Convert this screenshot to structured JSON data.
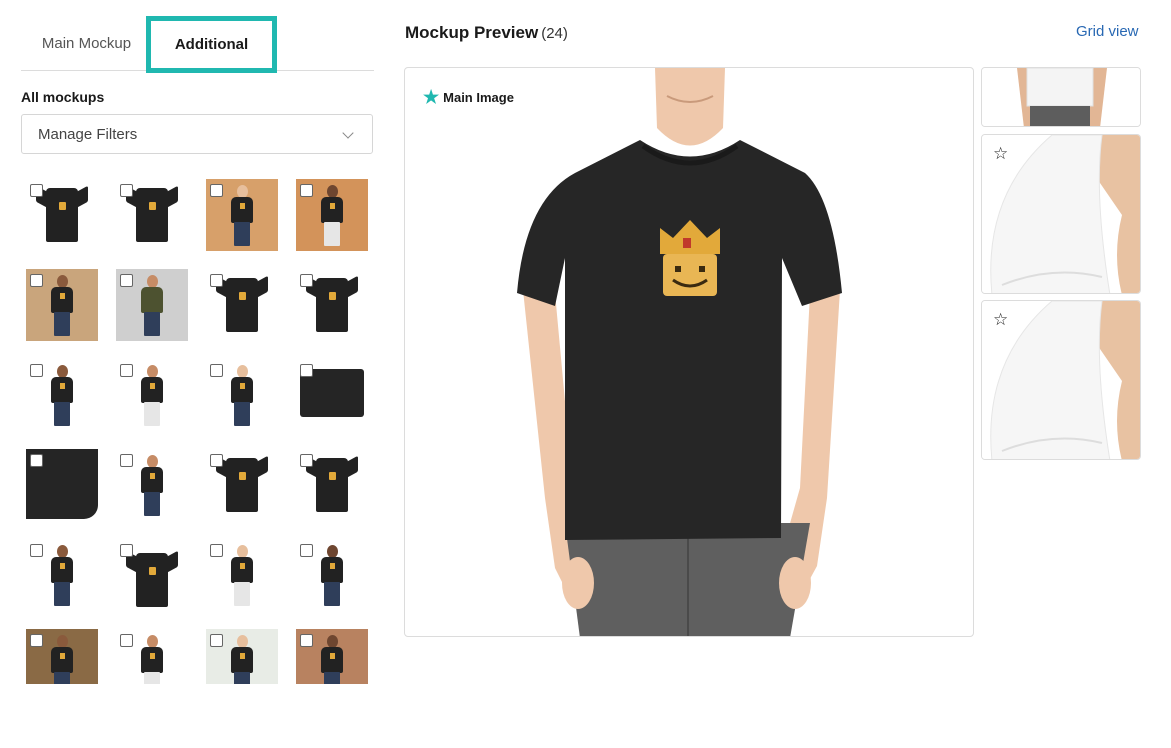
{
  "tabs": {
    "main_label": "Main Mockup",
    "additional_label": "Additional",
    "active": "Additional"
  },
  "filters": {
    "section_title": "All mockups",
    "select_label": "Manage Filters"
  },
  "preview": {
    "title": "Mockup Preview",
    "count": "(24)",
    "grid_view_label": "Grid view",
    "main_image_label": "Main Image"
  },
  "thumbnails": [
    {
      "kind": "flat-shirt",
      "bg": "#ffffff",
      "checked": false
    },
    {
      "kind": "flat-shirt",
      "bg": "#ffffff",
      "checked": false
    },
    {
      "kind": "model",
      "bg": "#d7a06a",
      "checked": false
    },
    {
      "kind": "model",
      "bg": "#d3935a",
      "checked": false
    },
    {
      "kind": "model",
      "bg": "#c9a57c",
      "checked": false
    },
    {
      "kind": "model-olive",
      "bg": "#cfcfcf",
      "checked": false
    },
    {
      "kind": "flat-shirt",
      "bg": "#ffffff",
      "checked": false
    },
    {
      "kind": "flat-shirt",
      "bg": "#ffffff",
      "checked": false
    },
    {
      "kind": "model",
      "bg": "#ffffff",
      "checked": false
    },
    {
      "kind": "model",
      "bg": "#ffffff",
      "checked": false
    },
    {
      "kind": "model",
      "bg": "#ffffff",
      "checked": false
    },
    {
      "kind": "folded",
      "bg": "#ffffff",
      "checked": false
    },
    {
      "kind": "closeup",
      "bg": "#ffffff",
      "checked": false
    },
    {
      "kind": "model",
      "bg": "#ffffff",
      "checked": false
    },
    {
      "kind": "flat-shirt",
      "bg": "#ffffff",
      "checked": false
    },
    {
      "kind": "flat-shirt",
      "bg": "#ffffff",
      "checked": false
    },
    {
      "kind": "model",
      "bg": "#ffffff",
      "checked": false
    },
    {
      "kind": "hanger",
      "bg": "#ffffff",
      "checked": false
    },
    {
      "kind": "model",
      "bg": "#ffffff",
      "checked": false
    },
    {
      "kind": "model",
      "bg": "#ffffff",
      "checked": false
    },
    {
      "kind": "model",
      "bg": "#8a6a45",
      "checked": false
    },
    {
      "kind": "model",
      "bg": "#ffffff",
      "checked": false
    },
    {
      "kind": "model",
      "bg": "#e8ece6",
      "checked": false
    },
    {
      "kind": "model",
      "bg": "#b88260",
      "checked": false
    }
  ],
  "side_cards": [
    {
      "kind": "white-back",
      "starred": false
    },
    {
      "kind": "white-sleeve",
      "starred": false
    },
    {
      "kind": "white-sleeve",
      "starred": false
    }
  ],
  "icons": {
    "main_star": "filled-star-icon",
    "side_star": "outline-star-icon",
    "dropdown": "chevron-down-icon"
  },
  "colors": {
    "accent": "#20b8b0",
    "link": "#2868b3",
    "shirt": "#222222",
    "logo": "#e2a93a"
  }
}
